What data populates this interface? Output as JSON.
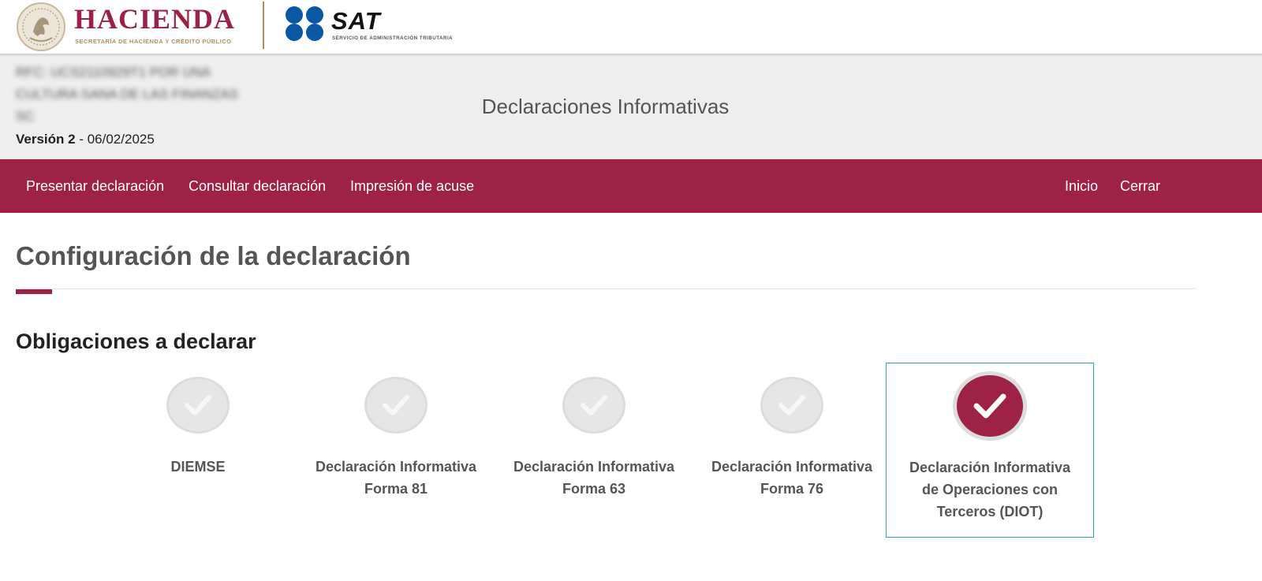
{
  "logos": {
    "hacienda_name": "HACIENDA",
    "hacienda_subtitle": "SECRETARÍA DE HACIENDA Y CRÉDITO PÚBLICO",
    "sat_name": "SAT",
    "sat_subtitle": "SERVICIO DE ADMINISTRACIÓN TRIBUTARIA"
  },
  "header": {
    "title": "Declaraciones Informativas",
    "rfc_lines": [
      "RFC: UCS2110929T1 POR UNA",
      "CULTURA SANA DE LAS FINANZAS",
      "SC"
    ],
    "version_label": "Versión 2",
    "version_separator": " - ",
    "version_date": "06/02/2025"
  },
  "nav": {
    "left_items": [
      "Presentar declaración",
      "Consultar declaración",
      "Impresión de acuse"
    ],
    "right_items": [
      "Inicio",
      "Cerrar"
    ]
  },
  "content": {
    "page_title": "Configuración de la declaración",
    "section_title": "Obligaciones a declarar",
    "obligations": [
      {
        "label_lines": [
          "DIEMSE"
        ],
        "selected": false,
        "icon": "check-icon"
      },
      {
        "label_lines": [
          "Declaración Informativa",
          "Forma 81"
        ],
        "selected": false,
        "icon": "check-icon"
      },
      {
        "label_lines": [
          "Declaración Informativa",
          "Forma 63"
        ],
        "selected": false,
        "icon": "check-icon"
      },
      {
        "label_lines": [
          "Declaración Informativa",
          "Forma 76"
        ],
        "selected": false,
        "icon": "check-icon"
      },
      {
        "label_lines": [
          "Declaración Informativa",
          "de Operaciones con",
          "Terceros (DIOT)"
        ],
        "selected": true,
        "icon": "check-icon"
      }
    ]
  },
  "colors": {
    "brand_crimson": "#9e2146",
    "gold": "#b38e5d",
    "sat_blue": "#0a57a4",
    "selection_border": "#2aa1d8"
  }
}
